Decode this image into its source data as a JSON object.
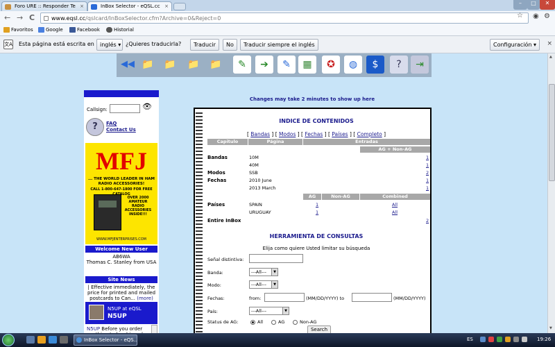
{
  "browser": {
    "tabs": [
      {
        "title": "Foro URE :: Responder Te",
        "close": "×"
      },
      {
        "title": "InBox Selector - eQSL.cc",
        "close": "×"
      }
    ],
    "nav": {
      "back": "←",
      "forward": "→",
      "reload": "C"
    },
    "url_host": "www.eqsl.cc",
    "url_path": "/qslcard/InBoxSelector.cfm?Archive=0&Reject=0",
    "toolbar_icons": {
      "star": "☆",
      "wrench": "⚙"
    },
    "window_controls": {
      "minimize": "–",
      "maximize": "□",
      "close": "✕"
    }
  },
  "bookmarks": [
    {
      "label": "Favoritos",
      "color": "#e0a020"
    },
    {
      "label": "Google",
      "color": "#4a80e0"
    },
    {
      "label": "Facebook",
      "color": "#3b5998"
    },
    {
      "label": "Historial",
      "color": "#555555"
    }
  ],
  "translate": {
    "icon": "文A",
    "text1": "Esta página está escrita en",
    "language": "inglés",
    "question": "¿Quieres traducirla?",
    "translate_btn": "Traducir",
    "no_btn": "No",
    "always_btn": "Traducir siempre el inglés",
    "config_btn": "Configuración",
    "close": "×"
  },
  "icon_toolbar": [
    {
      "name": "back-nav-icon",
      "glyph": "◀◀",
      "color": "#2a6ad8",
      "bg": "#9bb0c4"
    },
    {
      "name": "folder-back-icon",
      "glyph": "📁",
      "color": "#e8c020",
      "bg": "#9bb0c4"
    },
    {
      "name": "folder-clock-icon",
      "glyph": "📁",
      "color": "#e8c020",
      "bg": "#9bb0c4"
    },
    {
      "name": "folder-reject-icon",
      "glyph": "📁",
      "color": "#e8c020",
      "bg": "#9bb0c4"
    },
    {
      "name": "folder-forward-icon",
      "glyph": "📁",
      "color": "#e8c020",
      "bg": "#9bb0c4"
    },
    {
      "name": "edit-page-icon",
      "glyph": "✎",
      "color": "#2a8a2a",
      "bg": "#ffffff"
    },
    {
      "name": "export-page-icon",
      "glyph": "➔",
      "color": "#2a8a2a",
      "bg": "#ffffff"
    },
    {
      "name": "write-icon",
      "glyph": "✎",
      "color": "#2a6ad8",
      "bg": "#ffffff"
    },
    {
      "name": "picture-icon",
      "glyph": "▦",
      "color": "#3a8a3a",
      "bg": "#ffffff"
    },
    {
      "name": "award-icon",
      "glyph": "✪",
      "color": "#c82020",
      "bg": "#ffffff"
    },
    {
      "name": "globe-icon",
      "glyph": "◍",
      "color": "#2a6ad8",
      "bg": "#ffffff"
    },
    {
      "name": "dollar-icon",
      "glyph": "$",
      "color": "#ffffff",
      "bg": "#1a5ac8"
    },
    {
      "name": "help-icon",
      "glyph": "?",
      "color": "#333355",
      "bg": "#d8dcec"
    },
    {
      "name": "exit-door-icon",
      "glyph": "⇥",
      "color": "#2a8a2a",
      "bg": "#c4c8dc"
    }
  ],
  "sidebar": {
    "callsign_label": "Callsign:",
    "faq": "FAQ",
    "contact": "Contact Us",
    "ad": {
      "logo": "MFJ",
      "tagline": "... THE WORLD LEADER IN HAM RADIO ACCESSORIES!",
      "call": "CALL 1-800-647-1800 FOR FREE CATALOG",
      "box": "OVER 2000 AMATEUR RADIO ACCESSORIES INSIDE!!!",
      "site": "WWW.MFJENTERPRISES.COM"
    },
    "welcome_title": "Welcome New User",
    "welcome_call": "AB6WA",
    "welcome_name": "Thomas C. Stanley from USA",
    "news_title": "Site News",
    "news_text": "| Effective immediately, the price for printed and mailed postcards to Can...",
    "news_more": "(more)",
    "n5up_line1": "N5UP at eQSL",
    "n5up_line2": "N5UP",
    "n5up_call": "N5UP",
    "n5up_text": "Before you order anything to be shipped"
  },
  "main": {
    "changes_note": "Changes may take 2 minutes to show up here",
    "index_title": "INDICE DE CONTENIDOS",
    "index_links": [
      "Bandas",
      "Modos",
      "Fechas",
      "Países",
      "Completo"
    ],
    "headers": {
      "capitulo": "Capitulo",
      "pagina": "Página",
      "entradas": "Entradas",
      "ag_nonag": "AG + Non-AG",
      "ag": "AG",
      "nonag": "Non-AG",
      "combined": "Combined"
    },
    "sections": {
      "bandas": "Bandas",
      "modos": "Modos",
      "fechas": "Fechas",
      "paises": "Países",
      "entire": "Entire InBox"
    },
    "rows": [
      {
        "val": "10M",
        "count": "1"
      },
      {
        "val": "40M",
        "count": "1"
      },
      {
        "val": "SSB",
        "count": "2"
      },
      {
        "val": "2010 June",
        "count": "1"
      },
      {
        "val": "2013 March",
        "count": "1"
      }
    ],
    "countries": [
      {
        "name": "SPAIN",
        "ag": "1",
        "combined": "All"
      },
      {
        "name": "URUGUAY",
        "ag": "1",
        "combined": "All"
      }
    ],
    "entire_count": "2",
    "query_title": "HERRAMIENTA DE CONSULTAS",
    "query_sub": "Elija como quiere Usted limitar su búsqueda",
    "form": {
      "callsign_label": "Señal distintiva:",
      "band_label": "Banda:",
      "mode_label": "Modo:",
      "dates_label": "Fechas:",
      "country_label": "País:",
      "ag_label": "Status de AG:",
      "all_option": "---All---",
      "from": "from:",
      "date_hint1": "(MM/DD/YYYY) to",
      "date_hint2": "(MM/DD/YYYY)",
      "radio_all": "All",
      "radio_ag": "AG",
      "radio_nonag": "Non-AG",
      "search_btn": "Search"
    }
  },
  "taskbar": {
    "task_title": "InBox Selector - eQS...",
    "lang": "ES",
    "clock": "19:26"
  }
}
